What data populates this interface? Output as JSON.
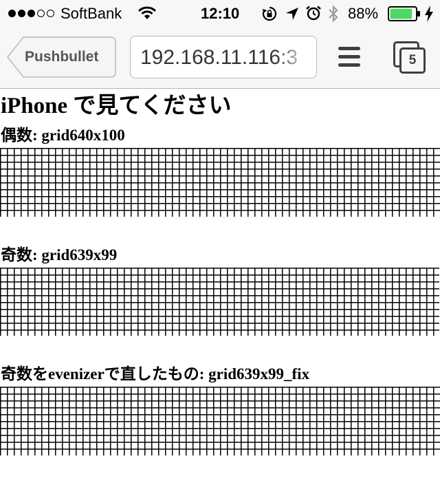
{
  "status_bar": {
    "carrier": "SoftBank",
    "time": "12:10",
    "battery_percent": "88%",
    "signal_bars_filled": 3,
    "signal_bars_total": 5,
    "battery_level": 0.88,
    "icons": [
      "wifi-icon",
      "rotation-lock-icon",
      "location-arrow-icon",
      "alarm-clock-icon",
      "bluetooth-icon",
      "battery-icon",
      "charging-bolt-icon"
    ]
  },
  "nav_bar": {
    "back_label": "Pushbullet",
    "url": "192.168.11.116:3",
    "tab_count": "5",
    "icons": [
      "back-chevron-icon",
      "menu-icon",
      "tabs-icon"
    ]
  },
  "content": {
    "title": "iPhone で見てください",
    "sections": [
      {
        "label": "偶数: grid640x100"
      },
      {
        "label": "奇数: grid639x99"
      },
      {
        "label": "奇数をevenizerで直したもの: grid639x99_fix"
      }
    ]
  },
  "colors": {
    "bar_background": "#f7f7f7",
    "battery_green": "#4cd964",
    "grid_line": "#000000"
  }
}
